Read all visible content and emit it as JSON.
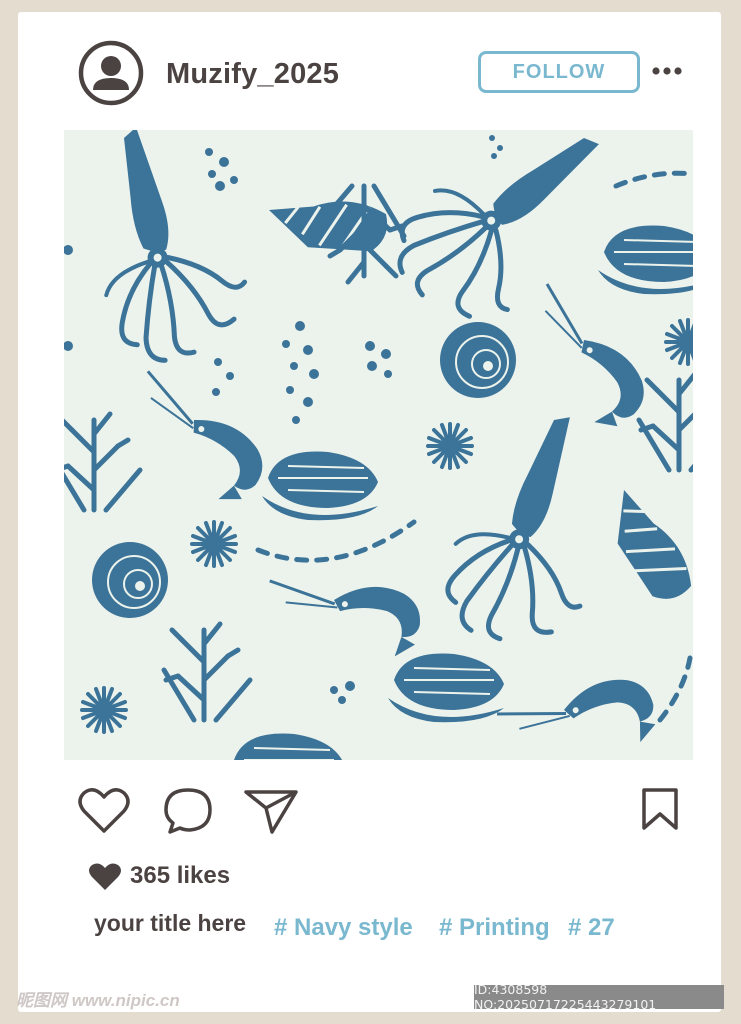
{
  "post": {
    "username": "Muzify_2025",
    "follow_label": "FOLLOW",
    "likes_text": "365 likes",
    "caption": "your title here",
    "tags": [
      "# Navy style",
      "# Printing",
      "# 27"
    ]
  },
  "image": {
    "background_color": "#ecf3ec",
    "ink_color": "#3c7398"
  },
  "colors": {
    "accent": "#79b8cf",
    "text": "#4b4341",
    "frame": "#e4dccf"
  },
  "icons": [
    "avatar",
    "more",
    "like",
    "comment",
    "share",
    "bookmark",
    "heart-filled"
  ],
  "watermark": {
    "site": "昵图网 www.nipic.cn",
    "id_text": "ID:4308598 NO:20250717225443279101"
  }
}
